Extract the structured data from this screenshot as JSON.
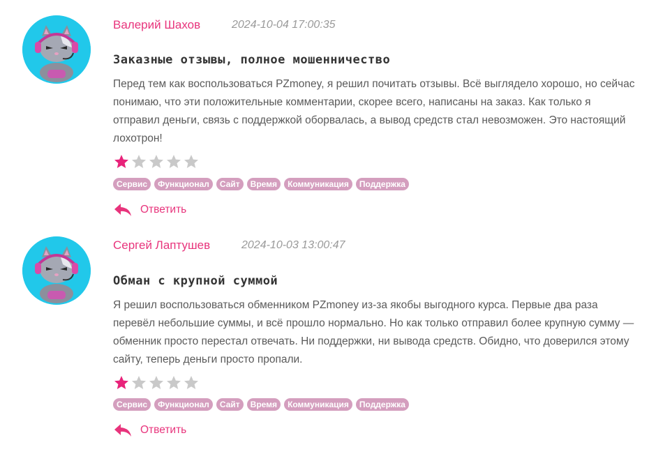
{
  "reviews": [
    {
      "author": "Валерий Шахов",
      "date": "2024-10-04 17:00:35",
      "title": "Заказные отзывы, полное мошенничество",
      "body": "Перед тем как воспользоваться PZmoney, я решил почитать отзывы. Всё выглядело хорошо, но сейчас понимаю, что эти положительные комментарии, скорее всего, написаны на заказ. Как только я отправил деньги, связь с поддержкой оборвалась, а вывод средств стал невозможен. Это настоящий лохотрон!",
      "rating": 1,
      "max_rating": 5,
      "tags": [
        "Сервис",
        "Функционал",
        "Сайт",
        "Время",
        "Коммуникация",
        "Поддержка"
      ],
      "reply_label": "Ответить"
    },
    {
      "author": "Сергей Лаптушев",
      "date": "2024-10-03 13:00:47",
      "title": "Обман с крупной суммой",
      "body": "Я решил воспользоваться обменником PZmoney из-за якобы выгодного курса. Первые два раза перевёл небольшие суммы, и всё прошло нормально. Но как только отправил более крупную сумму — обменник просто перестал отвечать. Ни поддержки, ни вывода средств. Обидно, что доверился этому сайту, теперь деньги просто пропали.",
      "rating": 1,
      "max_rating": 5,
      "tags": [
        "Сервис",
        "Функционал",
        "Сайт",
        "Время",
        "Коммуникация",
        "Поддержка"
      ],
      "reply_label": "Ответить"
    }
  ],
  "colors": {
    "accent": "#e8347c",
    "star_filled": "#e8237a",
    "star_empty": "#c9c9c9",
    "tag_bg": "#d49ebe",
    "avatar_bg": "#21c8ea"
  },
  "icons": {
    "avatar": "cat-gamer-avatar-icon",
    "star": "star-icon",
    "reply": "reply-arrow-icon"
  }
}
